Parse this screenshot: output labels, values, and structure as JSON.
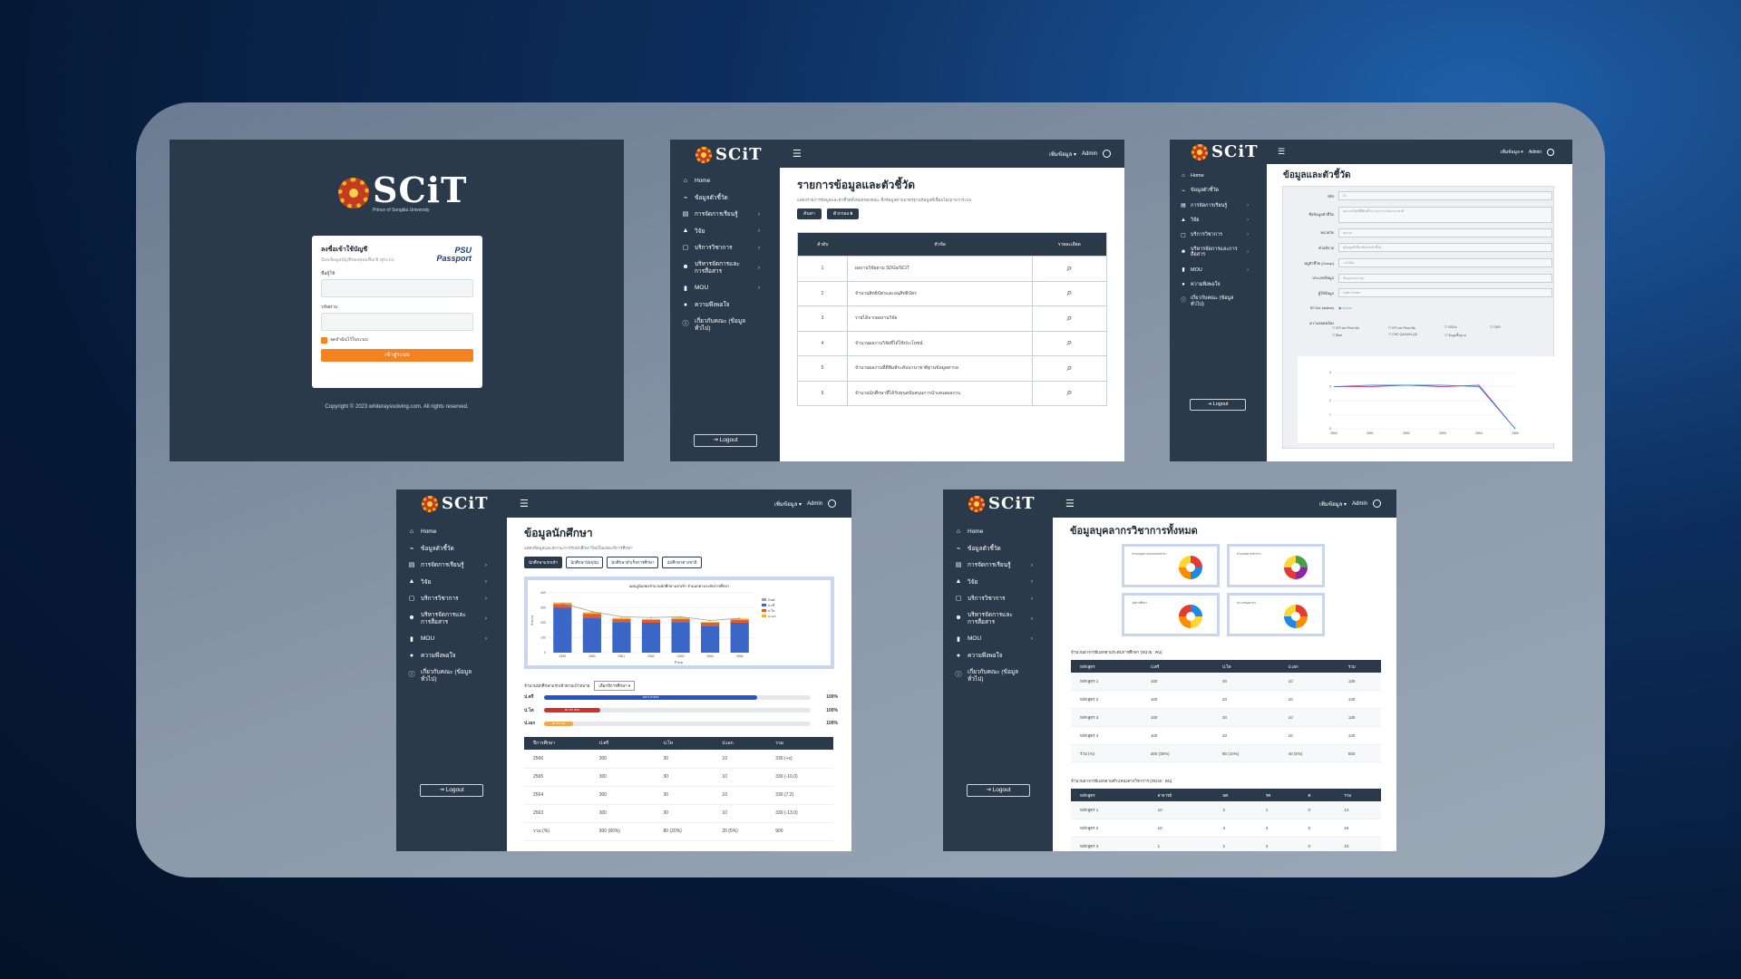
{
  "brand": {
    "name": "SCiT",
    "subtitle": "Prince of Songkla University"
  },
  "login": {
    "title": "ลงชื่อเข้าใช้บัญชี",
    "subtitle": "ป้อนข้อมูลบัญชีของคุณเพื่อเข้าสู่ระบบ",
    "passport_top": "PSU",
    "passport_bottom": "Passport",
    "username_label": "ชื่อผู้ใช้",
    "password_label": "รหัสผ่าน",
    "remember_label": "จดจำฉันไว้ในระบบ",
    "submit_label": "เข้าสู่ระบบ",
    "copyright": "Copyright © 2023 whiterayssolving.com. All rights reserved."
  },
  "topbar": {
    "add_data": "เพิ่มข้อมูล ▾",
    "admin": "Admin"
  },
  "nav": [
    {
      "icon": "⌂",
      "label": "Home",
      "arrow": ""
    },
    {
      "icon": "⌁",
      "label": "ข้อมูลตัวชี้วัด",
      "arrow": ""
    },
    {
      "icon": "▤",
      "label": "การจัดการเรียนรู้",
      "arrow": "›"
    },
    {
      "icon": "▲",
      "label": "วิจัย",
      "arrow": "›"
    },
    {
      "icon": "▢",
      "label": "บริการวิชาการ",
      "arrow": "›"
    },
    {
      "icon": "☻",
      "label": "บริหารจัดการและการสื่อสาร",
      "arrow": "›"
    },
    {
      "icon": "▮",
      "label": "MOU",
      "arrow": "›"
    },
    {
      "icon": "●",
      "label": "ความพึงพอใจ",
      "arrow": ""
    },
    {
      "icon": "ⓘ",
      "label": "เกี่ยวกับคณะ (ข้อมูลทั่วไป)",
      "arrow": ""
    }
  ],
  "logout_label": "Logout",
  "indicators_page": {
    "title": "รายการข้อมูลและตัวชี้วัด",
    "subtitle": "แสดงรายการข้อมูลและตัวชี้วัดทั้งหมดของคณะ ซึ่งข้อมูลตามมาตรฐานข้อมูลที่เชื่อมโยงมาจากระบบ",
    "chip_search": "ค้นหา",
    "chip_filter": "ตัวกรอง",
    "table_headers": [
      "ลำดับ",
      "หัวข้อ",
      "รายละเอียด"
    ],
    "rows": [
      {
        "no": "1",
        "topic": "ผลงานวิจัยตาม SDGs/SCiT"
      },
      {
        "no": "2",
        "topic": "จำนวนสิทธิบัตรและอนุสิทธิบัตร"
      },
      {
        "no": "3",
        "topic": "รายได้จากผลงานวิจัย"
      },
      {
        "no": "4",
        "topic": "จำนวนผลงานวิจัยที่ได้ใช้ประโยชน์"
      },
      {
        "no": "5",
        "topic": "จำนวนผลงานที่ตีพิมพ์ระดับนานาชาติฐานข้อมูลสากล"
      },
      {
        "no": "6",
        "topic": "จำนวนนักศึกษาที่ได้รับทุนสนับสนุนการนำเสนอผลงาน"
      }
    ]
  },
  "indicator_detail": {
    "title": "ข้อมูลและตัวชี้วัด",
    "fields": [
      {
        "label": "รหัส",
        "value": "01"
      },
      {
        "label": "ชื่อข้อมูลตัวชี้วัด",
        "value": "ผลงานวิจัยที่ตีพิมพ์ในวารสารระดับนานาชาติ"
      },
      {
        "label": "หน่วยวัด",
        "value": "ผลงาน"
      },
      {
        "label": "คำอธิบาย",
        "value": "ดูข้อมูลที่เกี่ยวข้องกับตัวชี้วัด"
      },
      {
        "label": "หมู่ตัวชี้วัด (Group)",
        "value": "งานวิจัย"
      },
      {
        "label": "ประเภทข้อมูล",
        "value": "ข้อมูลจากระบบ"
      },
      {
        "label": "ผู้ให้ข้อมูล",
        "value": "Data Center"
      },
      {
        "label": "สถานะ (active)",
        "value": "Active"
      },
      {
        "label": "ความสอดคล้อง",
        "value": ""
      }
    ],
    "checkboxes": [
      "KPI มหาวิทยาลัย",
      "KPI มหาวิทยาลัย",
      "SDGs",
      "OKR",
      "ทิศท",
      "CHE QA/AUN-QA",
      "ข้อมูลพื้นฐาน"
    ],
    "mini_chart": {
      "x": [
        "2560",
        "2561",
        "2562",
        "2563",
        "2564",
        "2565"
      ],
      "series": [
        {
          "color": "#d81b60",
          "values": [
            3,
            3,
            3.1,
            3,
            3.1,
            0
          ]
        },
        {
          "color": "#1e88e5",
          "values": [
            3,
            3.1,
            3.1,
            3.1,
            3,
            0
          ]
        }
      ],
      "yticks": [
        "4",
        "3",
        "2",
        "1",
        "0"
      ]
    }
  },
  "students_page": {
    "title": "ข้อมูลนักศึกษา",
    "subtitle": "แสดงข้อมูลและสถานะการรับนักศึกษาใหม่ในแต่ละปีการศึกษา",
    "tabs": [
      "นักศึกษาแรกเข้า",
      "นักศึกษาปัจจุบัน",
      "นักศึกษาสำเร็จการศึกษา",
      "นักศึกษาต่างชาติ"
    ],
    "chart_title": "แผนภูมิแสดงจำนวนนักศึกษาแรกเข้า จำแนกตามระดับการศึกษา",
    "select_label": "จำนวนนักศึกษาแรกเข้าตามเป้าหมาย",
    "select_value": "เลือกปีการศึกษา",
    "progress": [
      {
        "label": "ป.ตรี",
        "text": "325 จาก 80%",
        "pct": 80,
        "color": "#2456c9",
        "value": "100%"
      },
      {
        "label": "ป.โท",
        "text": "30 จาก 20%",
        "pct": 21,
        "color": "#d32f2f",
        "value": "100%"
      },
      {
        "label": "ป.เอก",
        "text": "20 จาก 5%",
        "pct": 11,
        "color": "#f0a84a",
        "value": "100%"
      }
    ],
    "table_headers": [
      "ปีการศึกษา",
      "ป.ตรี",
      "ป.โท",
      "ป.เอก",
      "รวม"
    ],
    "rows": [
      [
        "2566",
        "300",
        "30",
        "10",
        "330 (+x)"
      ],
      [
        "2565",
        "300",
        "30",
        "10",
        "330 (-10.0)"
      ],
      [
        "2564",
        "300",
        "30",
        "10",
        "330 (7.2)"
      ],
      [
        "2563",
        "300",
        "30",
        "10",
        "330 (-13.0)"
      ],
      [
        "รวม (%)",
        "900 (80%)",
        "80 (20%)",
        "20 (5%)",
        "900"
      ]
    ]
  },
  "chart_data": {
    "type": "bar",
    "title": "แผนภูมิแสดงจำนวนนักศึกษาแรกเข้า จำแนกตามระดับการศึกษา",
    "xlabel": "ปี พ.ศ.",
    "ylabel": "จำนวน",
    "ylim": [
      0,
      400
    ],
    "yticks": [
      0,
      100,
      200,
      300,
      400
    ],
    "categories": [
      "2559",
      "2560",
      "2561",
      "2562",
      "2563",
      "2564",
      "2565"
    ],
    "series": [
      {
        "name": "ป.ตรี",
        "color": "#3a66c8",
        "values": [
          300,
          235,
          205,
          200,
          205,
          180,
          200
        ]
      },
      {
        "name": "ป.โท",
        "color": "#e55a2a",
        "values": [
          25,
          25,
          20,
          20,
          20,
          20,
          20
        ]
      },
      {
        "name": "ป.เอก",
        "color": "#f2b233",
        "values": [
          10,
          10,
          8,
          5,
          10,
          5,
          8
        ]
      }
    ],
    "line": {
      "name": "Goal",
      "color": "#9e9e9e",
      "values": [
        330,
        275,
        240,
        235,
        240,
        215,
        230
      ]
    },
    "legend": "right"
  },
  "staff_page": {
    "title": "ข้อมูลบุคลากรวิชาการทั้งหมด",
    "donuts": [
      {
        "title": "จำนวนบุคลากรแยกตามสาขา",
        "segments": [
          "#e53935",
          "#1e88e5",
          "#fb8c00",
          "#fdd835"
        ]
      },
      {
        "title": "ตำแหน่งทางวิชาการ",
        "segments": [
          "#43a047",
          "#8e24aa",
          "#e53935",
          "#fdd835"
        ]
      },
      {
        "title": "วุฒิการศึกษา",
        "segments": [
          "#1e88e5",
          "#fdd835",
          "#fb8c00",
          "#e53935"
        ]
      },
      {
        "title": "ประเภทบุคลากร",
        "segments": [
          "#e53935",
          "#fb8c00",
          "#1e88e5",
          "#fdd835"
        ]
      }
    ],
    "caption1": "จำนวนอาจารย์แยกตามระดับการศึกษา (หน่วย : คน)",
    "table1_headers": [
      "หลักสูตร",
      "ป.ตรี",
      "ป.โท",
      "ป.เอก",
      "รวม"
    ],
    "table1_rows": [
      [
        "หลักสูตร 1",
        "100",
        "20",
        "10",
        "130"
      ],
      [
        "หลักสูตร 2",
        "100",
        "20",
        "10",
        "130"
      ],
      [
        "หลักสูตร 3",
        "100",
        "20",
        "10",
        "130"
      ],
      [
        "หลักสูตร 4",
        "100",
        "20",
        "10",
        "130"
      ],
      [
        "รวม (%)",
        "300 (30%)",
        "80 (10%)",
        "40 (5%)",
        "500"
      ]
    ],
    "caption2": "จำนวนอาจารย์แยกตามตำแหน่งทางวิชาการ (หน่วย : คน)",
    "table2_headers": [
      "หลักสูตร",
      "อาจารย์",
      "ผศ.",
      "รศ.",
      "ศ.",
      "รวม"
    ],
    "table2_rows": [
      [
        "หลักสูตร 1",
        "10",
        "2",
        "1",
        "0",
        "13"
      ],
      [
        "หลักสูตร 2",
        "10",
        "3",
        "3",
        "0",
        "16"
      ],
      [
        "หลักสูตร 3",
        "1",
        "2",
        "3",
        "0",
        "10"
      ]
    ]
  }
}
